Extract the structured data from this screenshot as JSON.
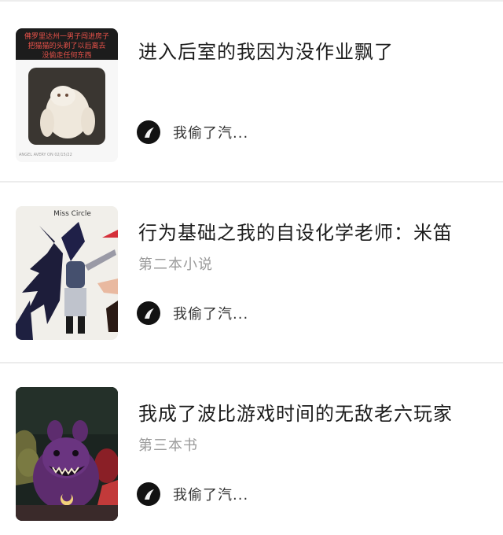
{
  "books": [
    {
      "title": "进入后室的我因为没作业飘了",
      "subtitle": "",
      "author": "我偷了汽...",
      "cover": {
        "caption_line1": "佛罗里达州一男子闯进房子",
        "caption_line2": "把猫猫的头剃了以后离去",
        "caption_line3": "没偷走任何东西",
        "footer": "ANGEL AVERY ON 02/15/22"
      }
    },
    {
      "title": "行为基础之我的自设化学老师：米笛",
      "subtitle": "第二本小说",
      "author": "我偷了汽...",
      "cover": {
        "caption_line1": "Miss Circle"
      }
    },
    {
      "title": "我成了波比游戏时间的无敌老六玩家",
      "subtitle": "第三本书",
      "author": "我偷了汽...",
      "cover": {}
    }
  ]
}
